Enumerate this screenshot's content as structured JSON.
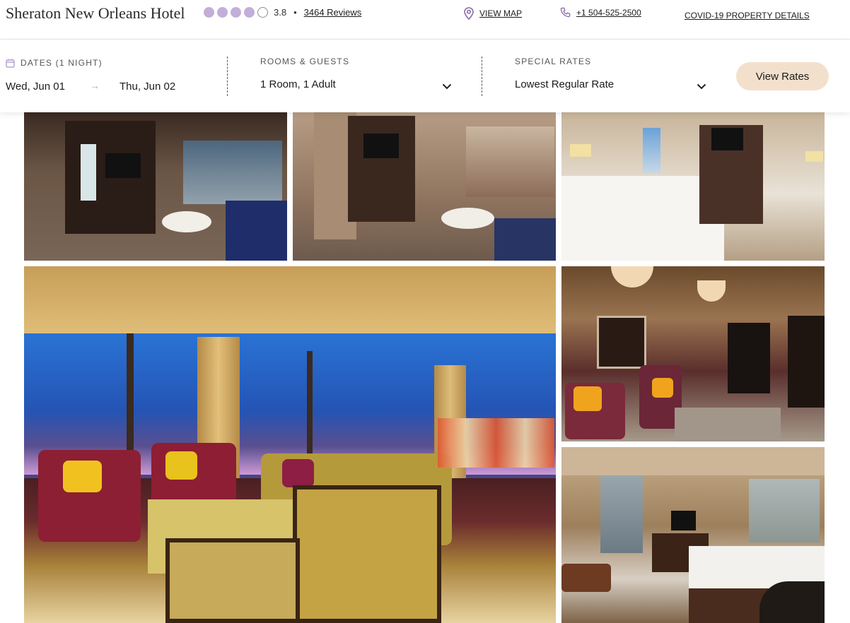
{
  "header": {
    "hotel_name": "Sheraton New Orleans Hotel",
    "rating": {
      "value": "3.8",
      "filled_dots": 4,
      "total_dots": 5,
      "dot_color": "#c3aed9"
    },
    "bullet": "•",
    "reviews_label": "3464 Reviews",
    "links": {
      "map_label": "VIEW MAP",
      "phone_label": "+1 504-525-2500",
      "covid_label": "COVID-19 PROPERTY DETAILS"
    },
    "icons": {
      "map": "map-pin-icon",
      "phone": "phone-icon"
    },
    "accent_color": "#8b6aa8"
  },
  "booking": {
    "dates_label": "DATES (1 NIGHT)",
    "dates_icon": "calendar-icon",
    "check_in": "Wed, Jun 01",
    "arrow": "→",
    "check_out": "Thu, Jun 02",
    "rooms_label": "ROOMS & GUESTS",
    "rooms_value": "1 Room, 1 Adult",
    "rates_label": "SPECIAL RATES",
    "rates_value": "Lowest Regular Rate",
    "chevron": "⌄",
    "view_rates_label": "View Rates",
    "button_color": "#f3e0cc"
  },
  "gallery": {
    "photos": [
      {
        "subject": "suite-living-room"
      },
      {
        "subject": "suite-living-room-tv"
      },
      {
        "subject": "guest-bedroom"
      },
      {
        "subject": "presidential-suite-living-room"
      },
      {
        "subject": "suite-lounge"
      },
      {
        "subject": "corner-king-room"
      }
    ]
  }
}
